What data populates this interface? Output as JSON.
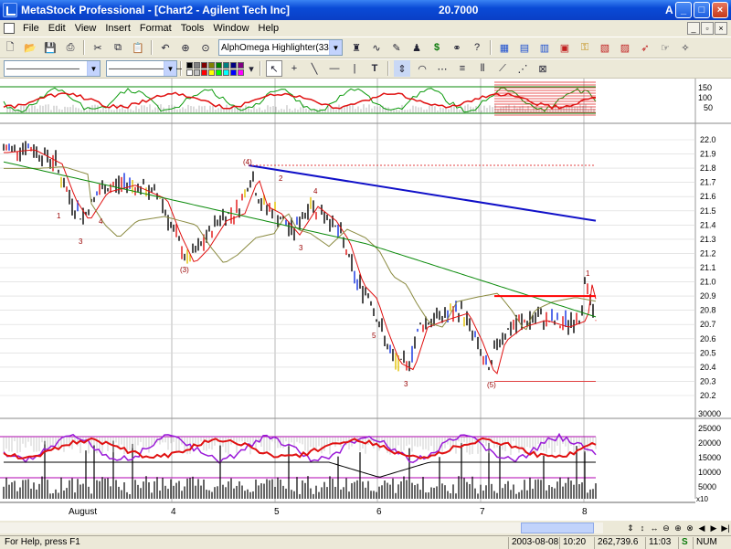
{
  "window": {
    "title": "MetaStock Professional - [Chart2 - Agilent Tech Inc]",
    "price": "20.7000",
    "alert_letter": "A",
    "buttons": {
      "minimize": "_",
      "maximize": "□",
      "close": "×"
    }
  },
  "menu": {
    "items": [
      "File",
      "Edit",
      "View",
      "Insert",
      "Format",
      "Tools",
      "Window",
      "Help"
    ],
    "mdi_buttons": [
      "_",
      "▫",
      "×"
    ]
  },
  "toolbar": {
    "expert_dropdown": "AlphOmega Highlighter(33)",
    "line_style_1": "————————",
    "line_style_2": "————————",
    "swatch_colors": [
      "#000000",
      "#808080",
      "#800000",
      "#808000",
      "#008000",
      "#008080",
      "#000080",
      "#800080",
      "#ffffff",
      "#c0c0c0",
      "#ff0000",
      "#ffff00",
      "#00ff00",
      "#00ffff",
      "#0000ff",
      "#ff00ff"
    ]
  },
  "chart": {
    "top_axis_labels": [
      "150",
      "100",
      "50"
    ],
    "price_axis_labels": [
      "22.0",
      "21.9",
      "21.8",
      "21.7",
      "21.6",
      "21.5",
      "21.4",
      "21.3",
      "21.2",
      "21.1",
      "21.0",
      "20.9",
      "20.8",
      "20.7",
      "20.6",
      "20.5",
      "20.4",
      "20.3",
      "20.2"
    ],
    "volume_axis_labels": [
      "30000",
      "25000",
      "20000",
      "15000",
      "10000",
      "5000"
    ],
    "volume_scale": "x10",
    "date_labels": [
      "August",
      "4",
      "5",
      "6",
      "7",
      "8"
    ],
    "annotations": [
      {
        "text": "(4)"
      },
      {
        "text": "(3)"
      },
      {
        "text": "(5)"
      },
      {
        "text": "1"
      },
      {
        "text": "2"
      },
      {
        "text": "3"
      },
      {
        "text": "4"
      },
      {
        "text": "5"
      },
      {
        "text": "3"
      },
      {
        "text": "3"
      },
      {
        "text": "1"
      },
      {
        "text": "4"
      }
    ],
    "colors": {
      "ma_red": "#e01010",
      "ma_green": "#0a8a0a",
      "ma_olive": "#8a8a40",
      "trend_blue": "#1010c8",
      "level_red": "#ff0000",
      "osc_purple": "#9a1ad8"
    }
  },
  "status": {
    "help": "For Help, press F1",
    "date": "2003-08-08",
    "time1": "10:20",
    "value": "262,739.6",
    "time2": "11:03",
    "mode1": "S",
    "mode2": "NUM"
  }
}
